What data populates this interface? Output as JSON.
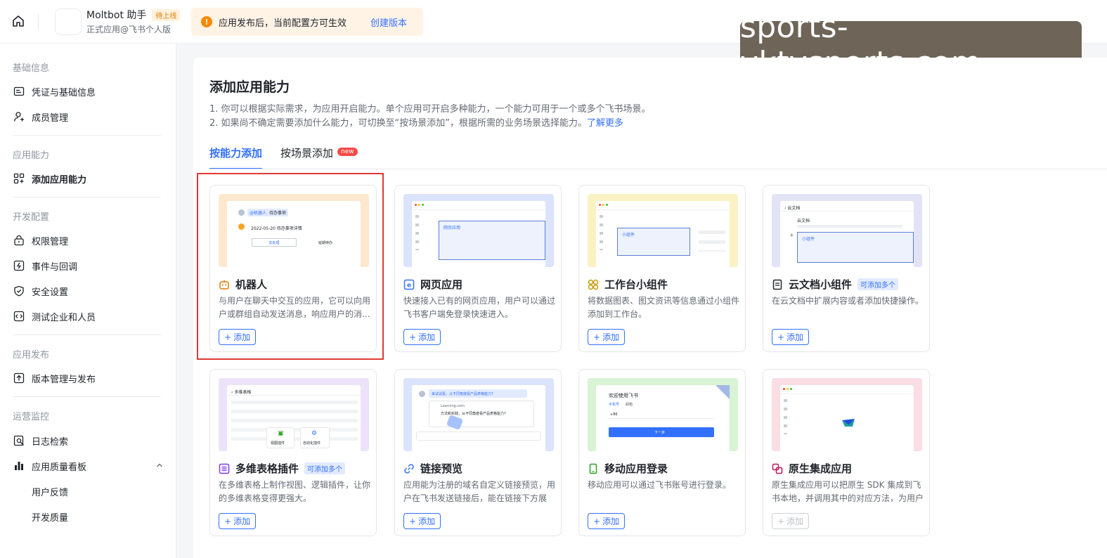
{
  "header": {
    "app_name": "Moltbot 助手",
    "app_status": "待上线",
    "app_subtitle": "正式应用@飞书个人版",
    "notice_text": "应用发布后，当前配置方可生效",
    "notice_link": "创建版本",
    "watermark": "sports-yktysports.com"
  },
  "sidebar": {
    "sections": [
      {
        "title": "基础信息",
        "items": [
          "凭证与基础信息",
          "成员管理"
        ]
      },
      {
        "title": "应用能力",
        "items": [
          "添加应用能力"
        ]
      },
      {
        "title": "开发配置",
        "items": [
          "权限管理",
          "事件与回调",
          "安全设置",
          "测试企业和人员"
        ]
      },
      {
        "title": "应用发布",
        "items": [
          "版本管理与发布"
        ]
      },
      {
        "title": "运营监控",
        "items": [
          "日志检索",
          "应用质量看板"
        ],
        "subitems": [
          "用户反馈",
          "开发质量"
        ]
      }
    ]
  },
  "main": {
    "title": "添加应用能力",
    "desc1": "1. 你可以根据实际需求，为应用开启能力。单个应用可开启多种能力，一个能力可用于一个或多个飞书场景。",
    "desc2": "2. 如果尚不确定需要添加什么能力，可切换至“按场景添加”，根据所需的业务场景选择能力。",
    "desc2_link": "了解更多",
    "tabs": [
      {
        "label": "按能力添加"
      },
      {
        "label": "按场景添加",
        "badge": "new"
      }
    ],
    "add_label": "添加",
    "cards": [
      {
        "title": "机器人",
        "desc": "与用户在聊天中交互的应用，它可以向用户或群组自动发送消息，响应用户的消...",
        "icon": "robot-icon",
        "color": "#de7802"
      },
      {
        "title": "网页应用",
        "desc": "快速接入已有的网页应用，用户可以通过飞书客户端免登录快速进入。",
        "icon": "web-app-icon",
        "color": "#3370ff"
      },
      {
        "title": "工作台小组件",
        "desc": "将数据图表、图文资讯等信息通过小组件添加到工作台。",
        "icon": "widget-icon",
        "color": "#d4a40a"
      },
      {
        "title": "云文档小组件",
        "tag": "可添加多个",
        "desc": "在云文档中扩展内容或者添加快捷操作。",
        "icon": "doc-widget-icon",
        "color": "#1f2329"
      },
      {
        "title": "多维表格插件",
        "tag": "可添加多个",
        "desc": "在多维表格上制作视图、逻辑插件，让你的多维表格变得更强大。",
        "icon": "bitable-plugin-icon",
        "color": "#7f3bf5"
      },
      {
        "title": "链接预览",
        "desc": "应用能为注册的域名自定义链接预览，用户在飞书发送链接后，能在链接下方展示...",
        "icon": "link-icon",
        "color": "#3370ff"
      },
      {
        "title": "移动应用登录",
        "desc": "移动应用可以通过飞书账号进行登录。",
        "icon": "mobile-login-icon",
        "color": "#2ea121"
      },
      {
        "title": "原生集成应用",
        "desc": "原生集成应用可以把原生 SDK 集成到飞书本地，并调用其中的对应方法，为用户提...",
        "icon": "native-app-icon",
        "color": "#c2185b",
        "disabled": true
      }
    ],
    "previews": {
      "robot_tag": "@机器人",
      "robot_task": "待办事项",
      "robot_date": "2022-05-20 待办事项详情",
      "robot_btn1": "去处理",
      "robot_btn2": "延期待办",
      "web_label": "网页应用",
      "widget_label": "小组件",
      "doc_title": "云文档",
      "doc_label": "云文档",
      "doc_widget": "小组件",
      "bitable_title": "多维表格",
      "bitable_view": "视图插件",
      "bitable_auto": "自动化插件",
      "link_msg": "来试试看，从不同角度看产品表格能力?",
      "link_url": "Learning.com",
      "link_preview": "方法和实践，从不同角度看产品表格能力?",
      "mobile_welcome": "欢迎使用飞书",
      "mobile_tab1": "手机号",
      "mobile_tab2": "邮箱",
      "mobile_code": "+86",
      "mobile_next": "下一步"
    }
  }
}
